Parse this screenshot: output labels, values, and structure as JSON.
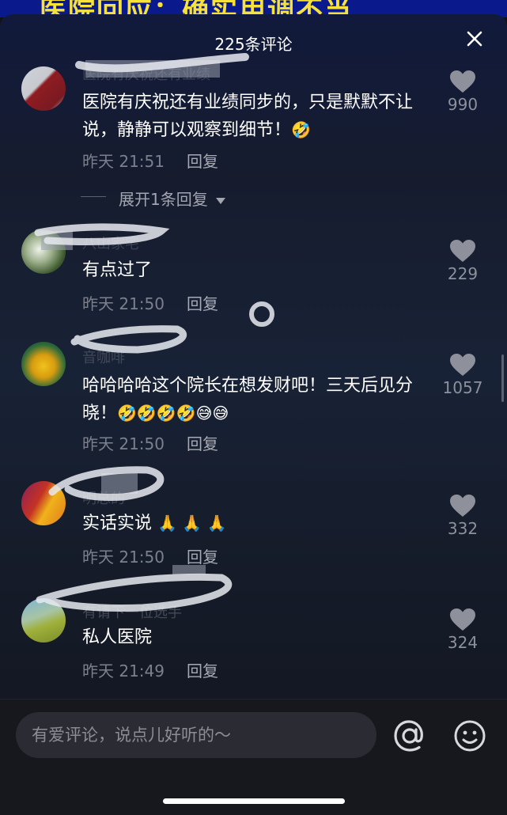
{
  "video_title_text": "医院回应：确实用调不当",
  "header": {
    "count_label": "225条评论"
  },
  "comments": [
    {
      "name": "医院有庆祝还有业绩",
      "text": "医院有庆祝还有业绩同步的，只是默默不让说，静静可以观察到细节！",
      "emojis": "🤣",
      "time": "昨天 21:51",
      "reply": "回复",
      "likes": "990"
    },
    {
      "name": "八山家宅",
      "text": "有点过了",
      "emojis": "",
      "time": "昨天 21:50",
      "reply": "回复",
      "likes": "229"
    },
    {
      "name": "音咖啡",
      "text": "哈哈哈哈这个院长在想发财吧！三天后见分晓！",
      "emojis": "🤣🤣🤣🤣😅😅",
      "time": "昨天 21:50",
      "reply": "回复",
      "likes": "1057"
    },
    {
      "name": "明总的",
      "text": "实话实说",
      "emojis": "🙏 🙏 🙏",
      "time": "昨天 21:50",
      "reply": "回复",
      "likes": "332"
    },
    {
      "name": "有请下一位选手",
      "text": "私人医院",
      "emojis": "",
      "time": "昨天 21:49",
      "reply": "回复",
      "likes": "324"
    }
  ],
  "expand_replies_label": "展开1条回复",
  "input": {
    "placeholder": "有爱评论，说点儿好听的～"
  },
  "icons": {
    "close": "close-icon",
    "like": "heart-icon",
    "mention": "at-icon",
    "emoji": "emoji-icon",
    "expand": "caret-down-icon"
  },
  "colors": {
    "background": "#121217",
    "secondary_text": "#7c808c",
    "video_banner": "#0a1a8c",
    "video_banner_text": "#f6e23a"
  }
}
